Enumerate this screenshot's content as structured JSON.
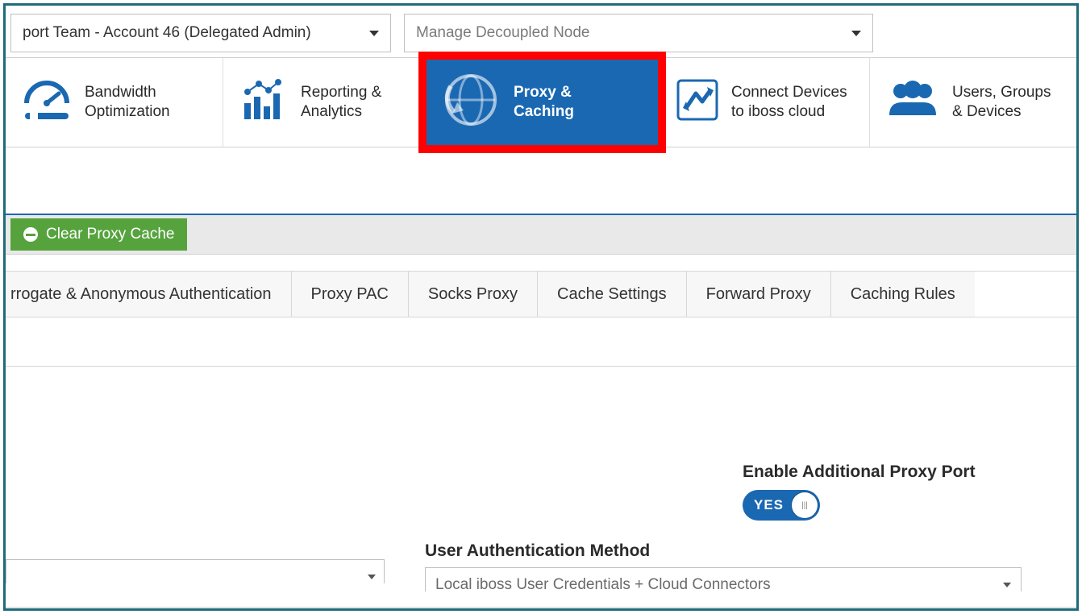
{
  "selectors": {
    "account": "port Team - Account 46 (Delegated Admin)",
    "node": "Manage Decoupled Node"
  },
  "nav": {
    "bandwidth": "Bandwidth Optimization",
    "reporting": "Reporting & Analytics",
    "proxy": "Proxy & Caching",
    "connect": "Connect Devices to iboss cloud",
    "users": "Users, Groups & Devices"
  },
  "actions": {
    "clear_cache": "Clear Proxy Cache"
  },
  "tabs": {
    "t1": "rrogate & Anonymous Authentication",
    "t2": "Proxy PAC",
    "t3": "Socks Proxy",
    "t4": "Cache Settings",
    "t5": "Forward Proxy",
    "t6": "Caching Rules"
  },
  "settings": {
    "enable_additional_port_label": "Enable Additional Proxy Port",
    "toggle_state": "YES",
    "auth_method_label": "User Authentication Method",
    "auth_method_value": "Local iboss User Credentials + Cloud Connectors"
  }
}
